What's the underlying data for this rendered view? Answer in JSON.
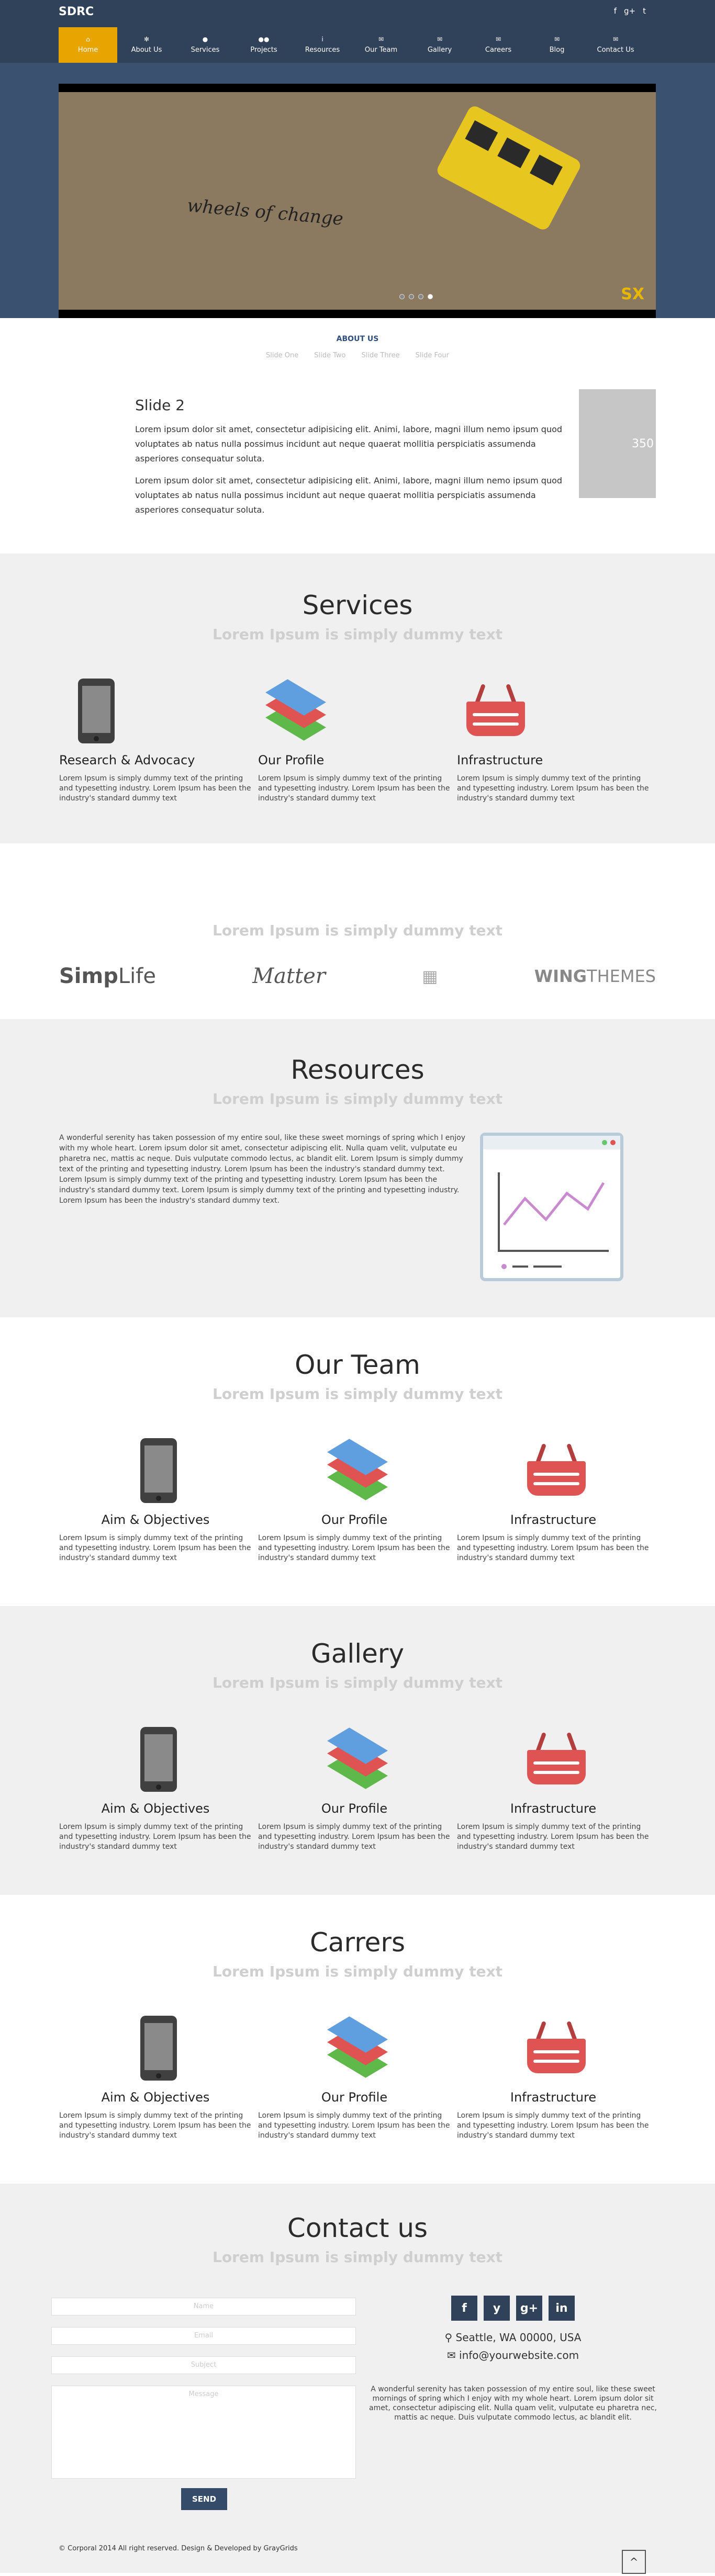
{
  "header": {
    "brand": "SDRC",
    "social": [
      "f",
      "g+",
      "t"
    ],
    "nav": [
      {
        "label": "Home",
        "icon": "home-icon",
        "glyph": "⌂"
      },
      {
        "label": "About Us",
        "icon": "gear-icon",
        "glyph": "✻"
      },
      {
        "label": "Services",
        "icon": "user-icon",
        "glyph": "●"
      },
      {
        "label": "Projects",
        "icon": "users-icon",
        "glyph": "●●"
      },
      {
        "label": "Resources",
        "icon": "info-icon",
        "glyph": "i"
      },
      {
        "label": "Our Team",
        "icon": "envelope-icon",
        "glyph": "✉"
      },
      {
        "label": "Gallery",
        "icon": "envelope-icon",
        "glyph": "✉"
      },
      {
        "label": "Careers",
        "icon": "envelope-icon",
        "glyph": "✉"
      },
      {
        "label": "Blog",
        "icon": "envelope-icon",
        "glyph": "✉"
      },
      {
        "label": "Contact Us",
        "icon": "envelope-icon",
        "glyph": "✉"
      }
    ],
    "slide_text": "wheels of change",
    "slide_logo": "SX"
  },
  "about": {
    "label": "ABOUT US",
    "tabs": [
      "Slide One",
      "Slide Two",
      "Slide Three",
      "Slide Four"
    ],
    "title": "Slide 2",
    "p1": "Lorem ipsum dolor sit amet, consectetur adipisicing elit. Animi, labore, magni illum nemo ipsum quod voluptates ab natus nulla possimus incidunt aut neque quaerat mollitia perspiciatis assumenda asperiores consequatur soluta.",
    "p2": "Lorem ipsum dolor sit amet, consectetur adipisicing elit. Animi, labore, magni illum nemo ipsum quod voluptates ab natus nulla possimus incidunt aut neque quaerat mollitia perspiciatis assumenda asperiores consequatur soluta.",
    "thumb": "350"
  },
  "services": {
    "title": "Services",
    "sub": "Lorem Ipsum is simply dummy text",
    "items": [
      {
        "title": "Research & Advocacy",
        "text": "Lorem Ipsum is simply dummy text of the printing and typesetting industry. Lorem Ipsum has been the industry's standard dummy text"
      },
      {
        "title": "Our Profile",
        "text": "Lorem Ipsum is simply dummy text of the printing and typesetting industry. Lorem Ipsum has been the industry's standard dummy text"
      },
      {
        "title": "Infrastructure",
        "text": "Lorem Ipsum is simply dummy text of the printing and typesetting industry. Lorem Ipsum has been the industry's standard dummy text"
      }
    ]
  },
  "partners": {
    "sub": "Lorem Ipsum is simply dummy text",
    "logos": [
      "Simp",
      "Life",
      "Matter",
      "WING",
      "THEMES"
    ]
  },
  "resources": {
    "title": "Resources",
    "sub": "Lorem Ipsum is simply dummy text",
    "text": "A wonderful serenity has taken possession of my entire soul, like these sweet mornings of spring which I enjoy with my whole heart. Lorem ipsum dolor sit amet, consectetur adipiscing elit. Nulla quam velit, vulputate eu pharetra nec, mattis ac neque. Duis vulputate commodo lectus, ac blandit elit. Lorem Ipsum is simply dummy text of the printing and typesetting industry. Lorem Ipsum has been the industry's standard dummy text. Lorem Ipsum is simply dummy text of the printing and typesetting industry. Lorem Ipsum has been the industry's standard dummy text. Lorem Ipsum is simply dummy text of the printing and typesetting industry. Lorem Ipsum has been the industry's standard dummy text."
  },
  "team": {
    "title": "Our Team",
    "sub": "Lorem Ipsum is simply dummy text",
    "items": [
      {
        "title": "Aim & Objectives",
        "text": "Lorem Ipsum is simply dummy text of the printing and typesetting industry. Lorem Ipsum has been the industry's standard dummy text"
      },
      {
        "title": "Our Profile",
        "text": "Lorem Ipsum is simply dummy text of the printing and typesetting industry. Lorem Ipsum has been the industry's standard dummy text"
      },
      {
        "title": "Infrastructure",
        "text": "Lorem Ipsum is simply dummy text of the printing and typesetting industry. Lorem Ipsum has been the industry's standard dummy text"
      }
    ]
  },
  "gallery": {
    "title": "Gallery",
    "sub": "Lorem Ipsum is simply dummy text",
    "items": [
      {
        "title": "Aim & Objectives",
        "text": "Lorem Ipsum is simply dummy text of the printing and typesetting industry. Lorem Ipsum has been the industry's standard dummy text"
      },
      {
        "title": "Our Profile",
        "text": "Lorem Ipsum is simply dummy text of the printing and typesetting industry. Lorem Ipsum has been the industry's standard dummy text"
      },
      {
        "title": "Infrastructure",
        "text": "Lorem Ipsum is simply dummy text of the printing and typesetting industry. Lorem Ipsum has been the industry's standard dummy text"
      }
    ]
  },
  "careers": {
    "title": "Carrers",
    "sub": "Lorem Ipsum is simply dummy text",
    "items": [
      {
        "title": "Aim & Objectives",
        "text": "Lorem Ipsum is simply dummy text of the printing and typesetting industry. Lorem Ipsum has been the industry's standard dummy text"
      },
      {
        "title": "Our Profile",
        "text": "Lorem Ipsum is simply dummy text of the printing and typesetting industry. Lorem Ipsum has been the industry's standard dummy text"
      },
      {
        "title": "Infrastructure",
        "text": "Lorem Ipsum is simply dummy text of the printing and typesetting industry. Lorem Ipsum has been the industry's standard dummy text"
      }
    ]
  },
  "contact": {
    "title": "Contact us",
    "sub": "Lorem Ipsum is simply dummy text",
    "name_ph": "Name",
    "email_ph": "Email",
    "subject_ph": "Subject",
    "message_ph": "Message",
    "send": "SEND",
    "social": [
      "f",
      "y",
      "g+",
      "in"
    ],
    "address": "Seattle, WA 00000, USA",
    "email": "info@yourwebsite.com",
    "text": "A wonderful serenity has taken possession of my entire soul, like these sweet mornings of spring which I enjoy with my whole heart. Lorem ipsum dolor sit amet, consectetur adipiscing elit. Nulla quam velit, vulputate eu pharetra nec, mattis ac neque. Duis vulputate commodo lectus, ac blandit elit."
  },
  "footer": {
    "copyright": "© Corporal 2014 All right reserved. Design & Developed by GrayGrids",
    "top": "^"
  },
  "colors": {
    "nav_active": "#e8a400",
    "navy": "#2f4259",
    "basket": "#e05353"
  }
}
